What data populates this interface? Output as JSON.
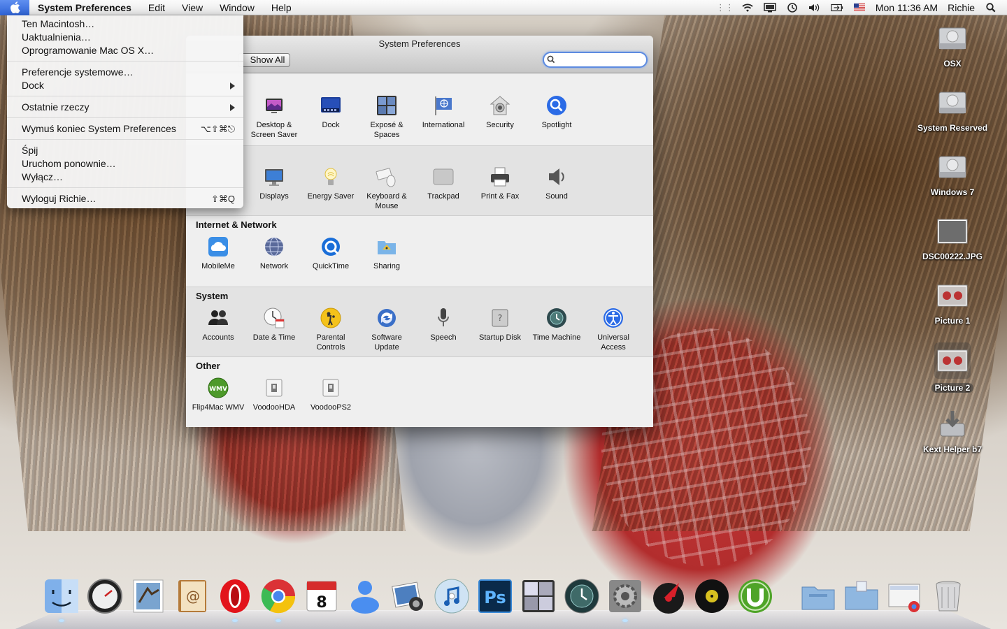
{
  "menubar": {
    "app_name": "System Preferences",
    "menus": [
      "Edit",
      "View",
      "Window",
      "Help"
    ],
    "clock": "Mon 11:36 AM",
    "user": "Richie"
  },
  "apple_menu": {
    "group1": [
      "Ten Macintosh…",
      "Uaktualnienia…",
      "Oprogramowanie Mac OS X…"
    ],
    "prefs": "Preferencje systemowe…",
    "dock": "Dock",
    "recent": "Ostatnie rzeczy",
    "force_quit": "Wymuś koniec System Preferences",
    "force_quit_shortcut": "⌥⇧⌘⎋",
    "sleep": "Śpij",
    "restart": "Uruchom ponownie…",
    "shutdown": "Wyłącz…",
    "logout": "Wyloguj Richie…",
    "logout_shortcut": "⇧⌘Q"
  },
  "prefs_window": {
    "title": "System Preferences",
    "show_all": "Show All",
    "search_placeholder": "",
    "sections": {
      "personal": {
        "label": "",
        "items": [
          "Desktop & Screen Saver",
          "Dock",
          "Exposé & Spaces",
          "International",
          "Security",
          "Spotlight"
        ]
      },
      "hardware": {
        "label": "",
        "items": [
          "Displays",
          "Energy Saver",
          "Keyboard & Mouse",
          "Trackpad",
          "Print & Fax",
          "Sound"
        ]
      },
      "internet": {
        "label": "Internet & Network",
        "items": [
          "MobileMe",
          "Network",
          "QuickTime",
          "Sharing"
        ]
      },
      "system": {
        "label": "System",
        "items": [
          "Accounts",
          "Date & Time",
          "Parental Controls",
          "Software Update",
          "Speech",
          "Startup Disk",
          "Time Machine",
          "Universal Access"
        ]
      },
      "other": {
        "label": "Other",
        "items": [
          "Flip4Mac WMV",
          "VoodooHDA",
          "VoodooPS2"
        ]
      }
    }
  },
  "desktop_icons": [
    "OSX",
    "System Reserved",
    "Windows 7",
    "DSC00222.JPG",
    "Picture 1",
    "Picture 2",
    "Kext Helper b7"
  ],
  "dock_apps": [
    "Finder",
    "Dashboard",
    "Mail",
    "Address Book",
    "Opera",
    "Google Chrome",
    "iCal",
    "iChat",
    "iPhoto",
    "iTunes",
    "Photoshop",
    "Spaces",
    "Time Machine",
    "System Preferences",
    "Scrobbler",
    "Vinyl",
    "uTorrent",
    "Applications",
    "Documents",
    "Downloads",
    "Trash"
  ],
  "colors": {
    "menu_highlight": "#2f63d6",
    "search_ring": "#5d8be0"
  }
}
